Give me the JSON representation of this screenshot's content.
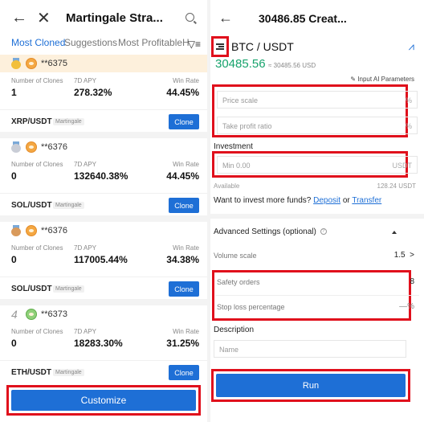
{
  "left": {
    "title": "Martingale Stra...",
    "tabs": [
      "Most Cloned",
      "Suggestions",
      "Most Profitable",
      "H"
    ],
    "customize_label": "Customize",
    "cards": [
      {
        "rank_style": "gold",
        "user": "**6375",
        "clones_label": "Number of Clones",
        "clones": "1",
        "apy_label": "7D APY",
        "apy": "278.32%",
        "win_label": "Win Rate",
        "win": "44.45%",
        "pair": "XRP/USDT",
        "tag": "Martingale",
        "clone_label": "Clone"
      },
      {
        "rank_style": "silver",
        "user": "**6376",
        "clones_label": "Number of Clones",
        "clones": "0",
        "apy_label": "7D APY",
        "apy": "132640.38%",
        "win_label": "Win Rate",
        "win": "44.45%",
        "pair": "SOL/USDT",
        "tag": "Martingale",
        "clone_label": "Clone"
      },
      {
        "rank_style": "bronze",
        "user": "**6376",
        "clones_label": "Number of Clones",
        "clones": "0",
        "apy_label": "7D APY",
        "apy": "117005.44%",
        "win_label": "Win Rate",
        "win": "34.38%",
        "pair": "SOL/USDT",
        "tag": "Martingale",
        "clone_label": "Clone"
      },
      {
        "rank_num": "4",
        "user": "**6373",
        "clones_label": "Number of Clones",
        "clones": "0",
        "apy_label": "7D APY",
        "apy": "18283.30%",
        "win_label": "Win Rate",
        "win": "31.25%",
        "pair": "ETH/USDT",
        "tag": "Martingale",
        "clone_label": "Clone"
      }
    ]
  },
  "right": {
    "title": "30486.85 Creat...",
    "pair": "BTC / USDT",
    "price": "30485.56",
    "price_usd": "≈ 30485.56 USD",
    "ai_params": "Input AI Parameters",
    "price_scale_placeholder": "Price scale",
    "price_scale_unit": "%",
    "take_profit_placeholder": "Take profit ratio",
    "take_profit_unit": "%",
    "investment_label": "Investment",
    "investment_placeholder": "Min 0.00",
    "investment_unit": "USDT",
    "available_label": "Available",
    "available_value": "128.24 USDT",
    "invest_more_text": "Want to invest more funds?",
    "deposit_link": "Deposit",
    "or_text": "or",
    "transfer_link": "Transfer",
    "advanced_label": "Advanced Settings (optional)",
    "volume_scale_label": "Volume scale",
    "volume_scale_value": "1.5",
    "safety_orders_label": "Safety orders",
    "safety_orders_value": "8",
    "stop_loss_label": "Stop loss percentage",
    "stop_loss_value": "—%",
    "description_label": "Description",
    "name_placeholder": "Name",
    "run_label": "Run"
  },
  "colors": {
    "accent": "#1e6fd6",
    "highlight": "#e0101c",
    "price": "#16a36c"
  }
}
